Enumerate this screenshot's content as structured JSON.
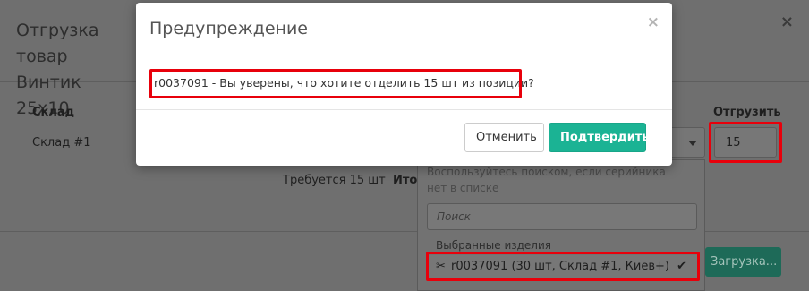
{
  "background_modal": {
    "title_line1": "Отгрузка товар",
    "title_line2": "Винтик 25х10",
    "close_label": "×",
    "col_warehouse": "Склад",
    "col_ship": "Отгрузить",
    "warehouse_name": "Склад #1",
    "ship_qty": "15",
    "required_text": "Требуется 15 шт",
    "total_text": "Ито",
    "load_button_label": "Загрузка..."
  },
  "dropdown": {
    "hint": "Воспользуйтесь поиском, если серийника нет в списке",
    "search_placeholder": "Поиск",
    "section_label": "Выбранные изделия",
    "item": {
      "code": "r0037091",
      "details": "(30 шт, Склад #1, Киев+)",
      "icon": "scissors-icon",
      "selected_icon": "check-icon"
    }
  },
  "dialog": {
    "title": "Предупреждение",
    "close_label": "×",
    "message": "r0037091 - Вы уверены, что хотите отделить 15 шт из позиции?",
    "cancel_label": "Отменить",
    "confirm_label": "Подтвердить"
  },
  "colors": {
    "overlay_dim": "#6f6f6f",
    "confirm_green": "#1bb394",
    "highlight_red": "#e8000b"
  }
}
